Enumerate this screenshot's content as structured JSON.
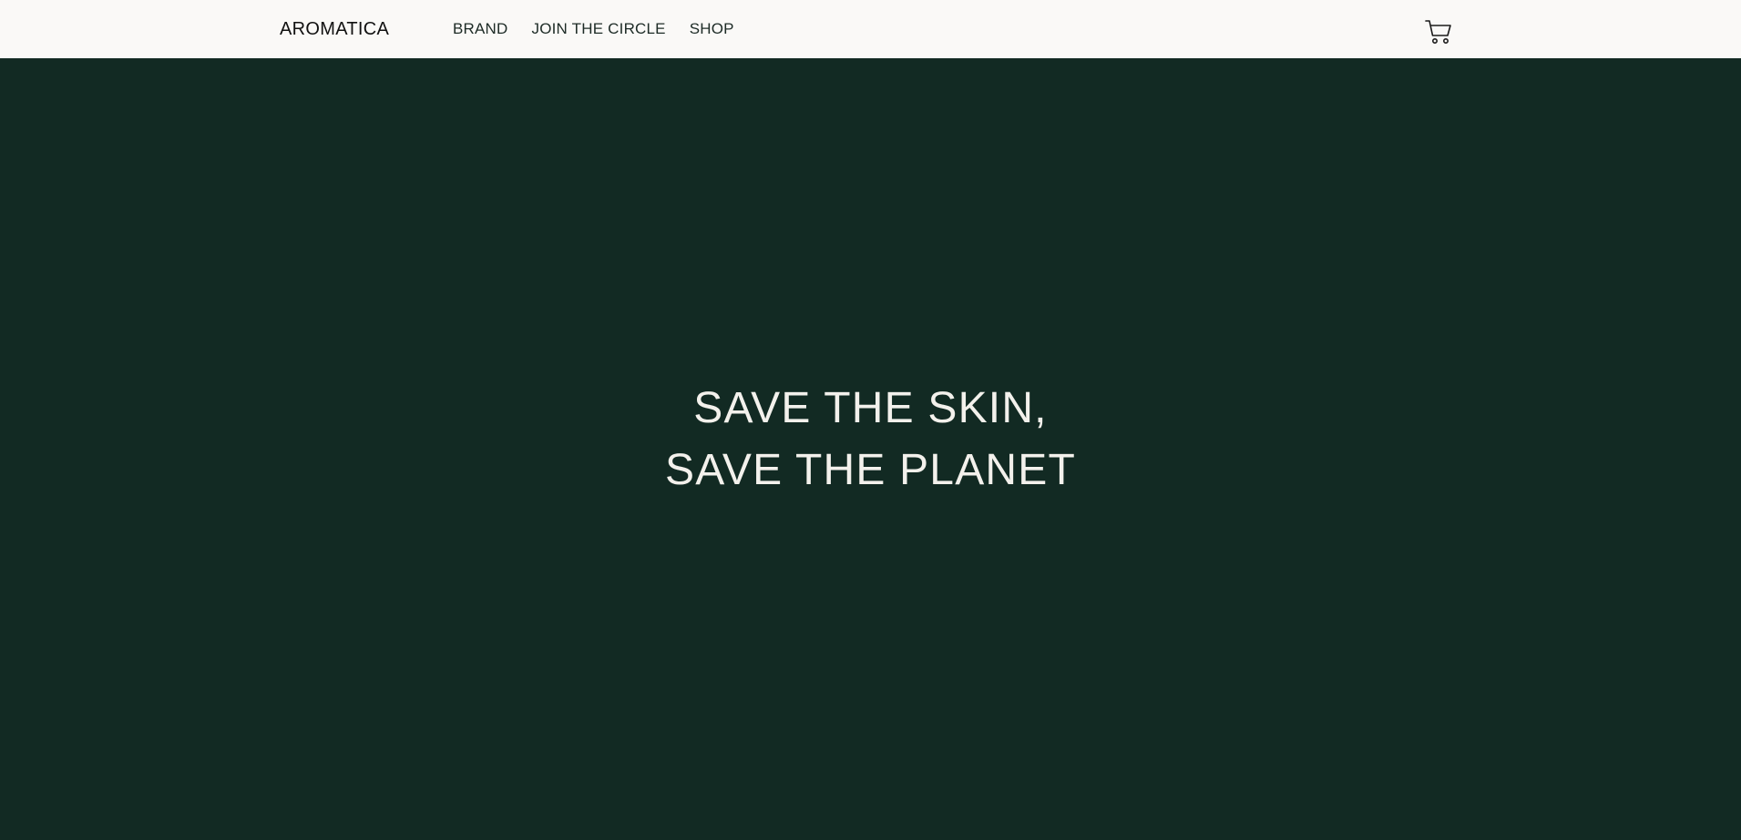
{
  "header": {
    "logo": "AROMATICA",
    "nav": [
      {
        "label": "BRAND"
      },
      {
        "label": "JOIN THE CIRCLE"
      },
      {
        "label": "SHOP"
      }
    ],
    "cart_icon": "shopping-cart-icon"
  },
  "hero": {
    "line1": "SAVE THE SKIN,",
    "line2": "SAVE THE PLANET"
  },
  "colors": {
    "header_bg": "#faf9f7",
    "hero_bg": "#122a23",
    "hero_text": "#f3f1ec"
  }
}
